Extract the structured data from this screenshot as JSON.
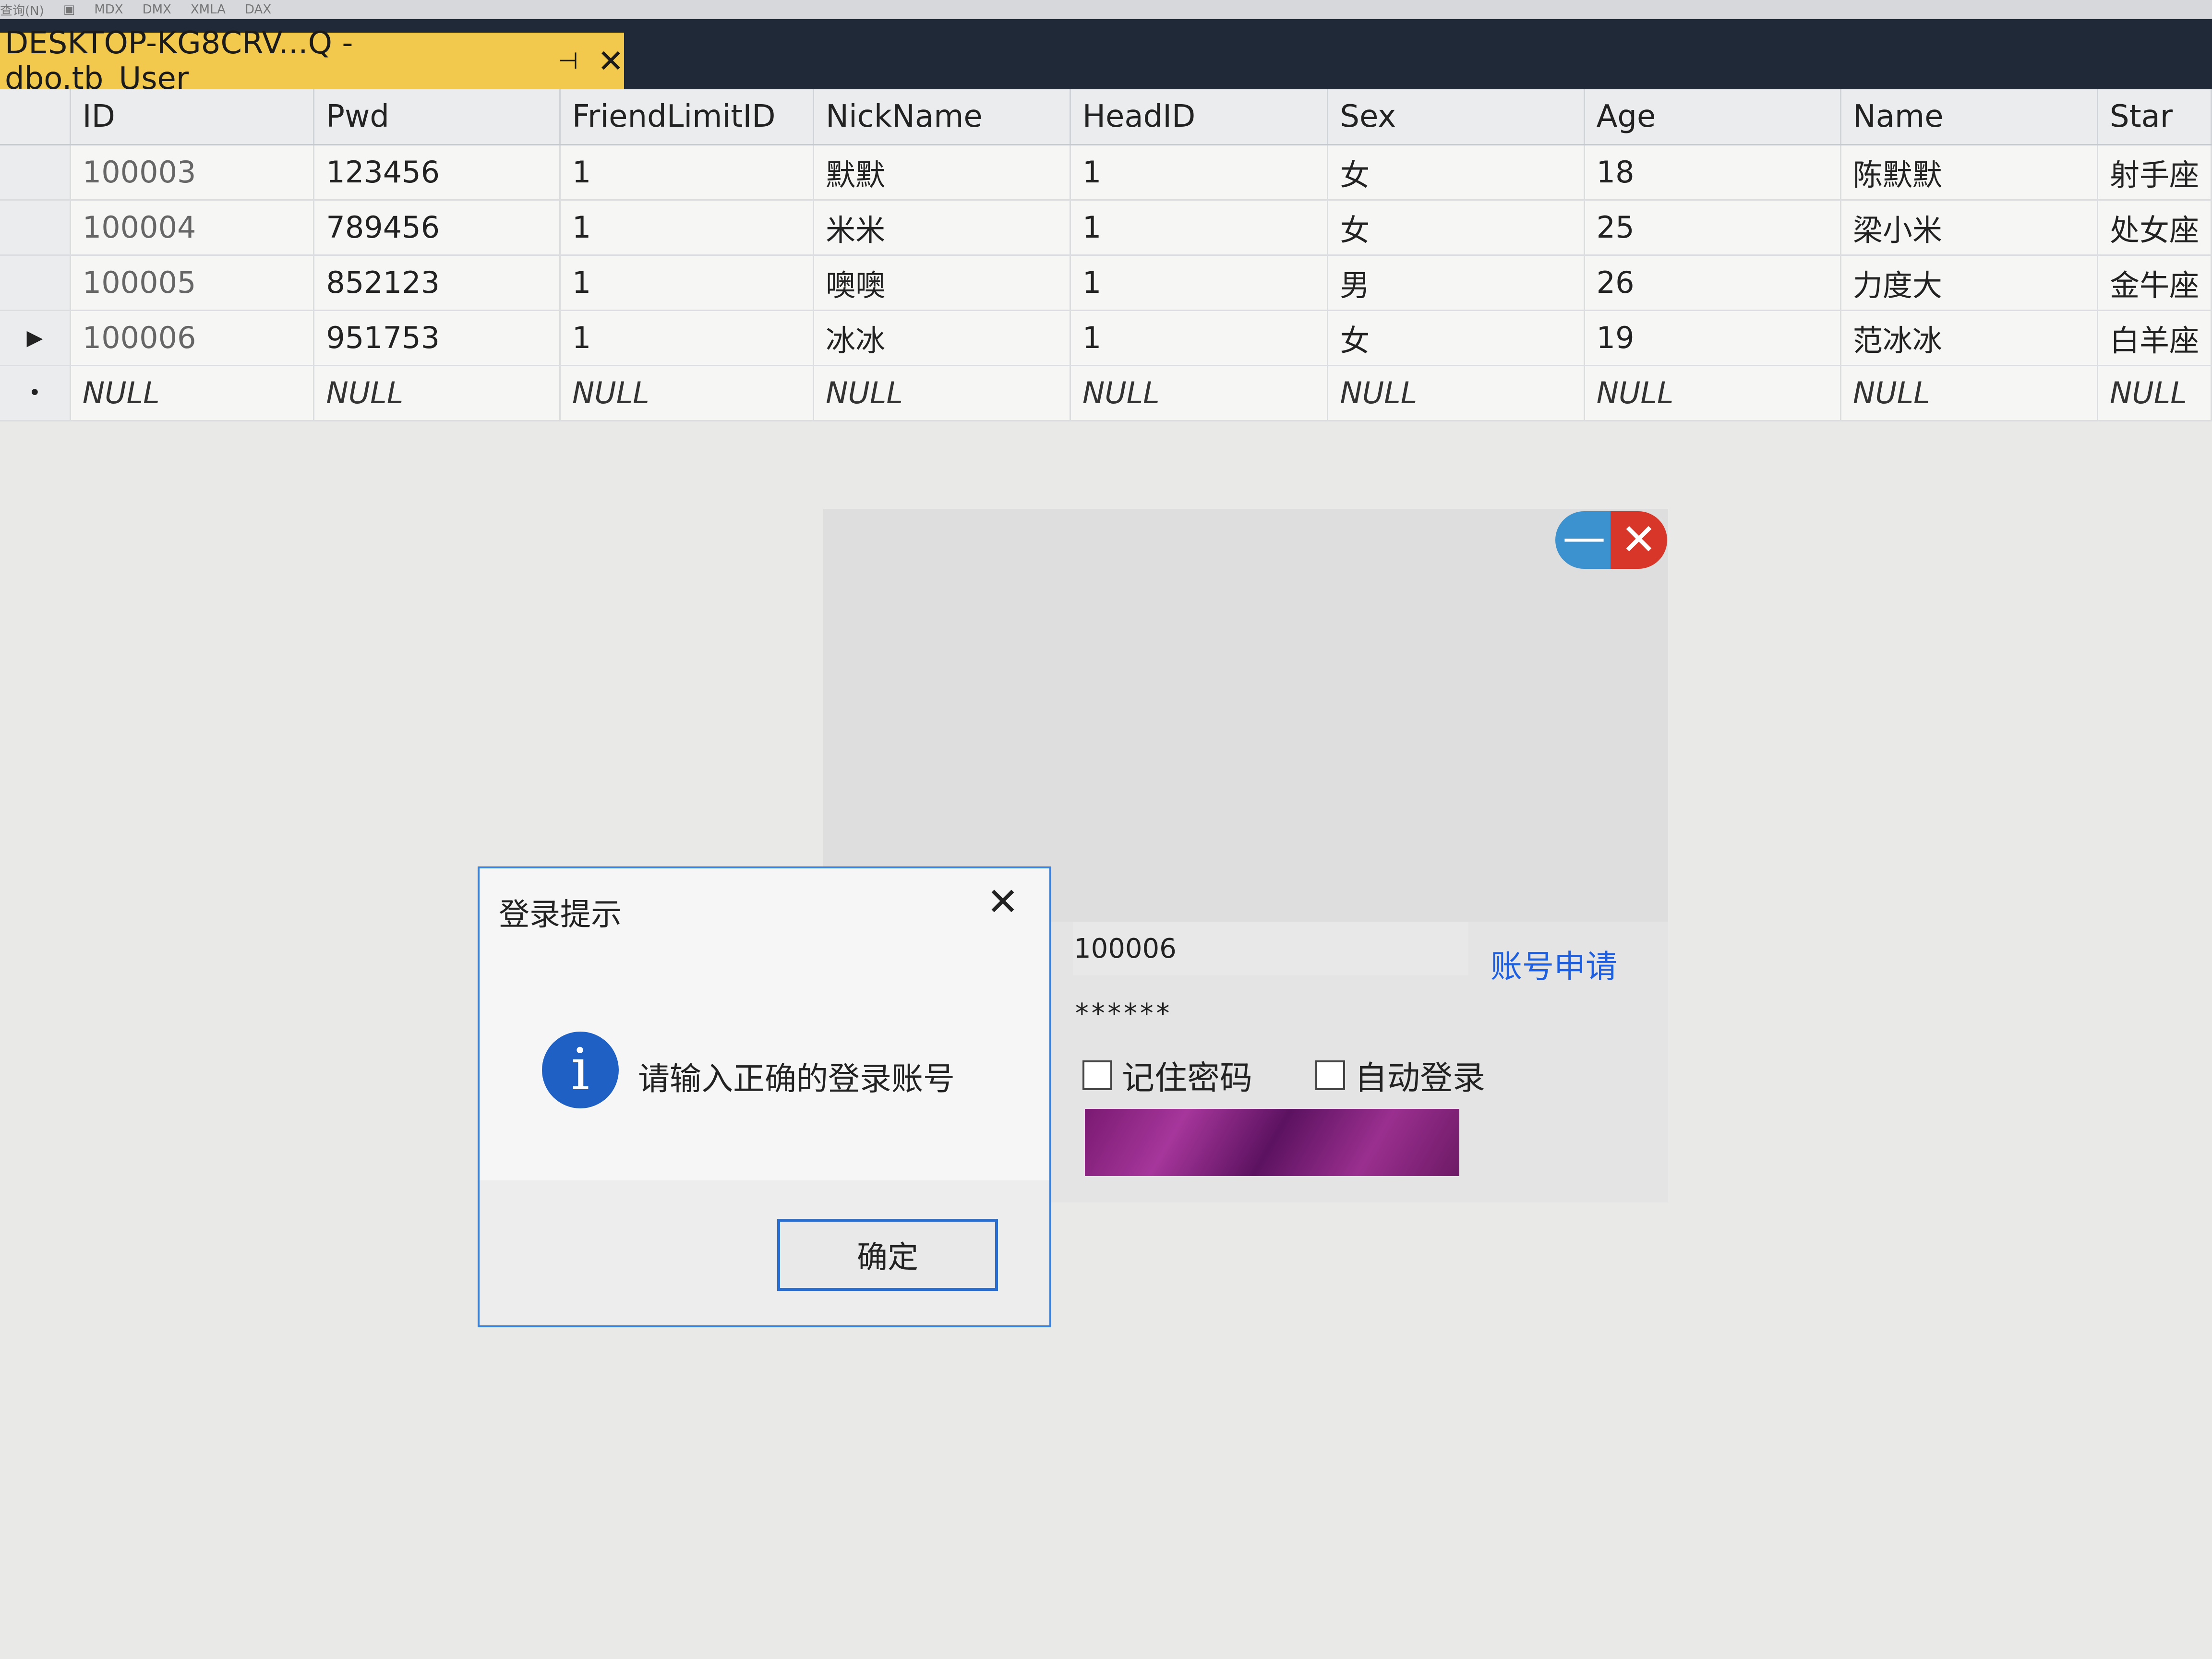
{
  "toolbar": {
    "items": [
      "查询(N)",
      "▣",
      "MDX",
      "DMX",
      "XMLA",
      "DAX"
    ]
  },
  "document_tab": {
    "title": "DESKTOP-KG8CRV...Q - dbo.tb_User",
    "pin_icon": "pin-icon",
    "close_icon": "close-icon"
  },
  "grid": {
    "columns": [
      "ID",
      "Pwd",
      "FriendLimitID",
      "NickName",
      "HeadID",
      "Sex",
      "Age",
      "Name",
      "Star"
    ],
    "rows": [
      {
        "marker": "",
        "cells": [
          "100003",
          "123456",
          "1",
          "默默",
          "1",
          "女",
          "18",
          "陈默默",
          "射手座"
        ]
      },
      {
        "marker": "",
        "cells": [
          "100004",
          "789456",
          "1",
          "米米",
          "1",
          "女",
          "25",
          "梁小米",
          "处女座"
        ]
      },
      {
        "marker": "",
        "cells": [
          "100005",
          "852123",
          "1",
          "噢噢",
          "1",
          "男",
          "26",
          "力度大",
          "金牛座"
        ]
      },
      {
        "marker": "▶",
        "cells": [
          "100006",
          "951753",
          "1",
          "冰冰",
          "1",
          "女",
          "19",
          "范冰冰",
          "白羊座"
        ]
      },
      {
        "marker": "•",
        "cells": [
          "NULL",
          "NULL",
          "NULL",
          "NULL",
          "NULL",
          "NULL",
          "NULL",
          "NULL",
          "NULL"
        ]
      }
    ]
  },
  "login": {
    "minimize_label": "—",
    "close_label": "✕",
    "account_value": "100006",
    "password_value": "******",
    "register_link": "账号申请",
    "remember_password": "记住密码",
    "auto_login": "自动登录"
  },
  "message_box": {
    "title": "登录提示",
    "icon_glyph": "i",
    "message": "请输入正确的登录账号",
    "ok_label": "确定",
    "close_glyph": "✕"
  },
  "colors": {
    "accent": "#3c7fd6",
    "tab": "#f2c94c",
    "titlebar": "#1f2938",
    "link": "#1e5fe0"
  }
}
